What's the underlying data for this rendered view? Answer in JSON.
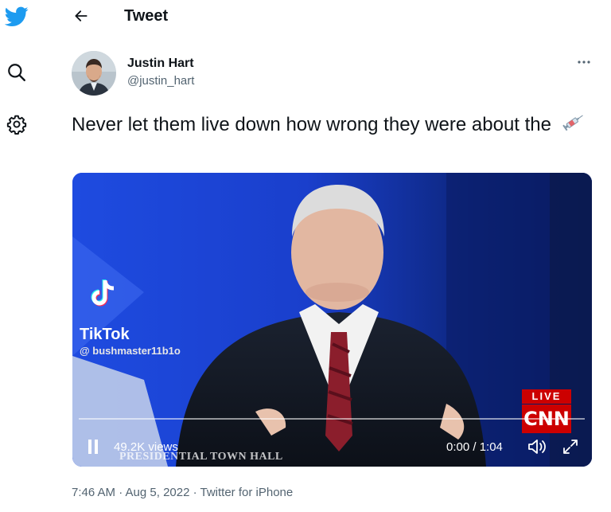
{
  "header": {
    "title": "Tweet"
  },
  "author": {
    "name": "Justin Hart",
    "handle": "@justin_hart"
  },
  "tweet": {
    "text": "Never let them live down how wrong they were about the",
    "emoji": "syringe-icon"
  },
  "video": {
    "watermark_app": "TikTok",
    "watermark_handle": "@ bushmaster11b1o",
    "live_label": "LIVE",
    "network": "CNN",
    "views": "49.2K views",
    "event": "PRESIDENTIAL TOWN HALL",
    "time": "0:00 / 1:04",
    "progress": 0.0
  },
  "footer": {
    "meta": "7:46 AM · Aug 5, 2022 · Twitter for iPhone"
  },
  "colors": {
    "brand": "#1d9bf0",
    "text": "#0f1419",
    "muted": "#536471",
    "cnn_red": "#cc0000"
  }
}
